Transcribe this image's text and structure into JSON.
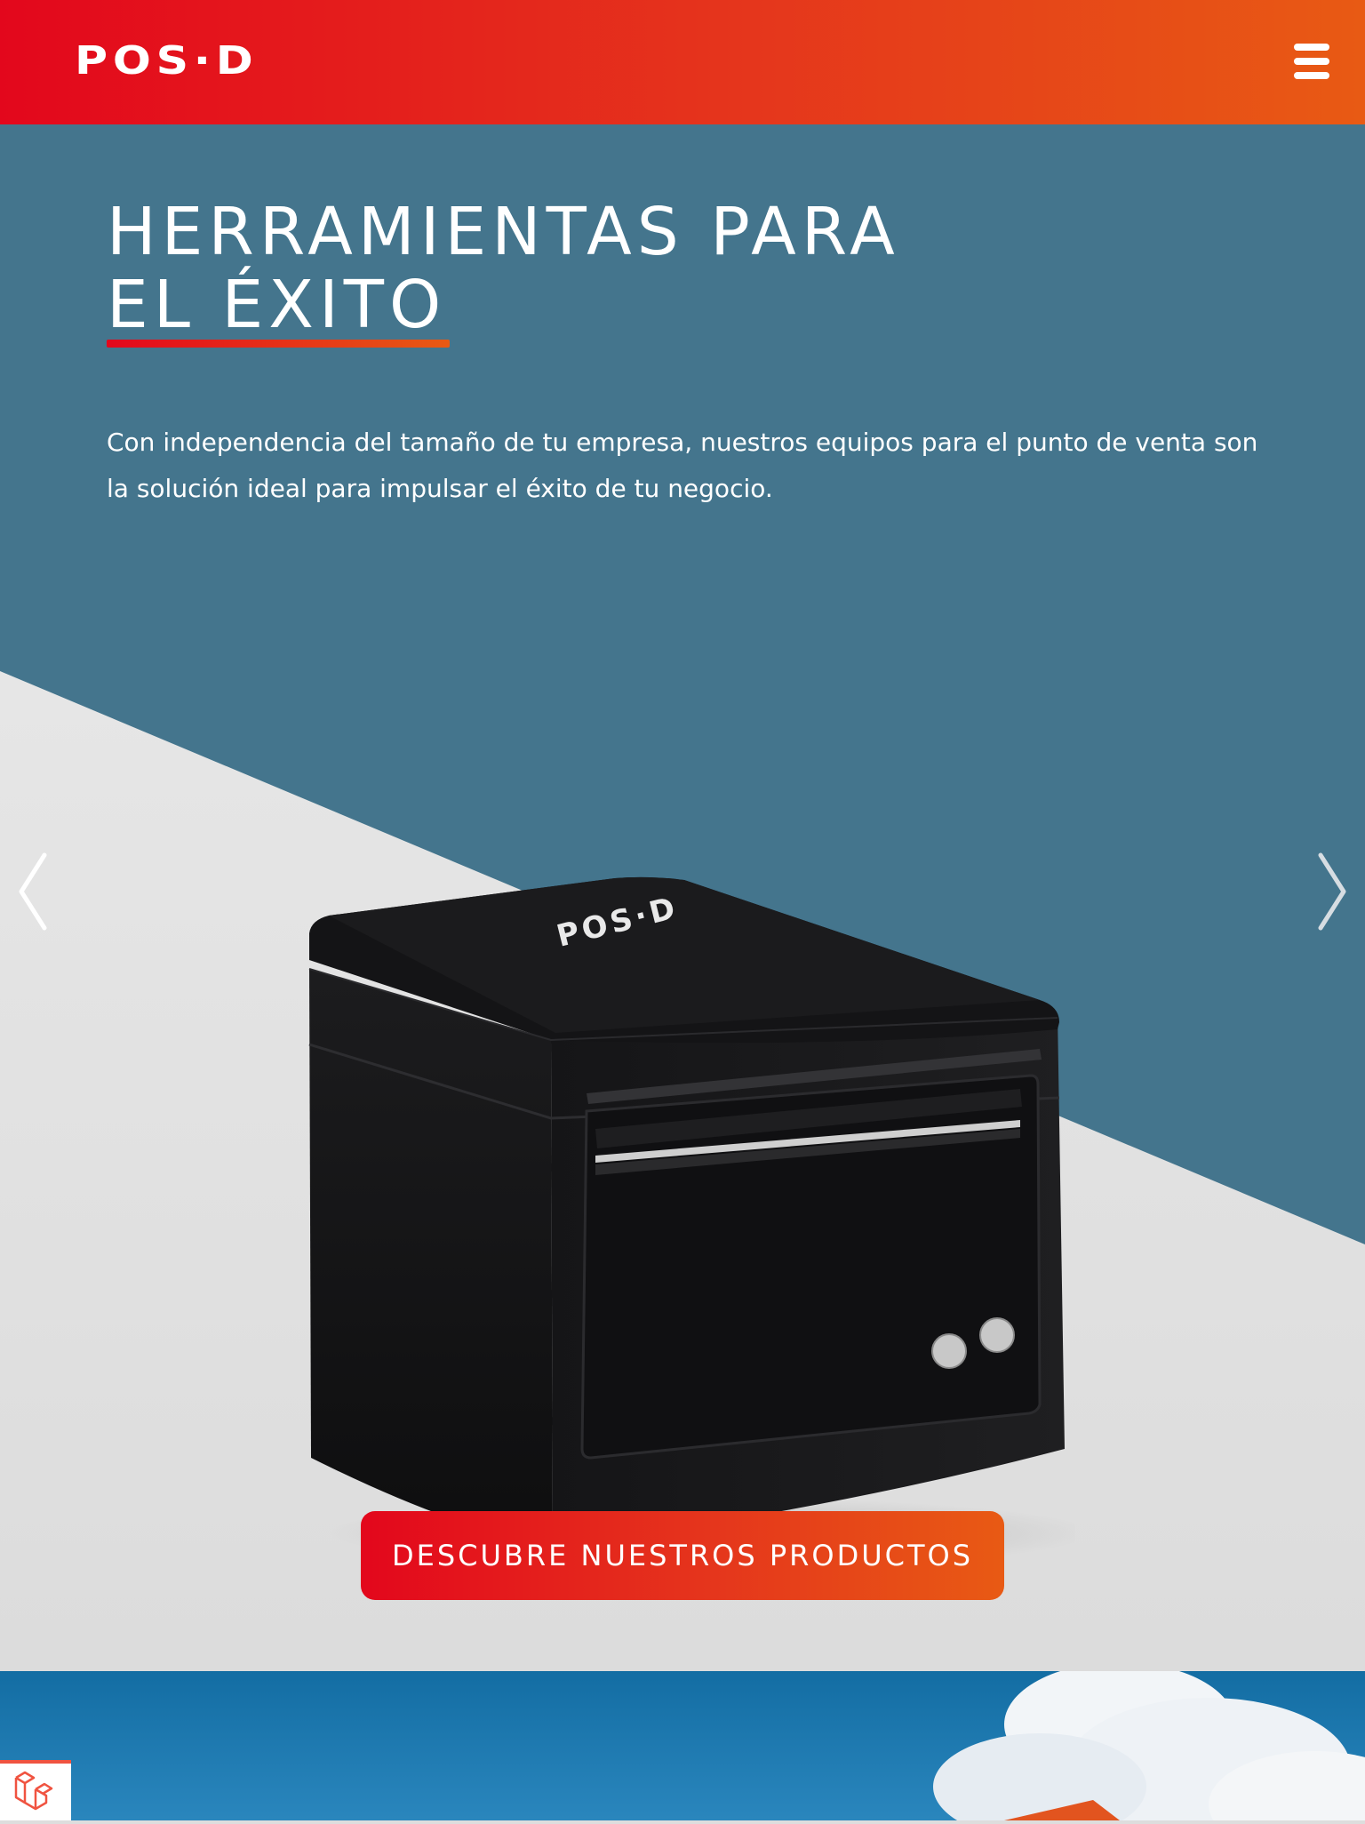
{
  "header": {
    "logo_text": "POS·D",
    "menu_icon": "hamburger-menu-icon"
  },
  "hero": {
    "title_line1": "HERRAMIENTAS PARA",
    "title_line2": "EL ÉXITO",
    "description": "Con independencia del tamaño de tu empresa, nuestros equipos para el punto de venta son la solución ideal para impulsar el éxito de tu negocio.",
    "product_logo_text": "POS·D",
    "cta_label": "DESCUBRE NUESTROS PRODUCTOS",
    "prev_icon": "chevron-left-icon",
    "next_icon": "chevron-right-icon"
  },
  "colors": {
    "brand_red": "#e3071c",
    "brand_orange": "#e85a14",
    "hero_bg": "#44758d",
    "floor": "#dedede"
  },
  "corner_badge_icon": "laravel-icon"
}
